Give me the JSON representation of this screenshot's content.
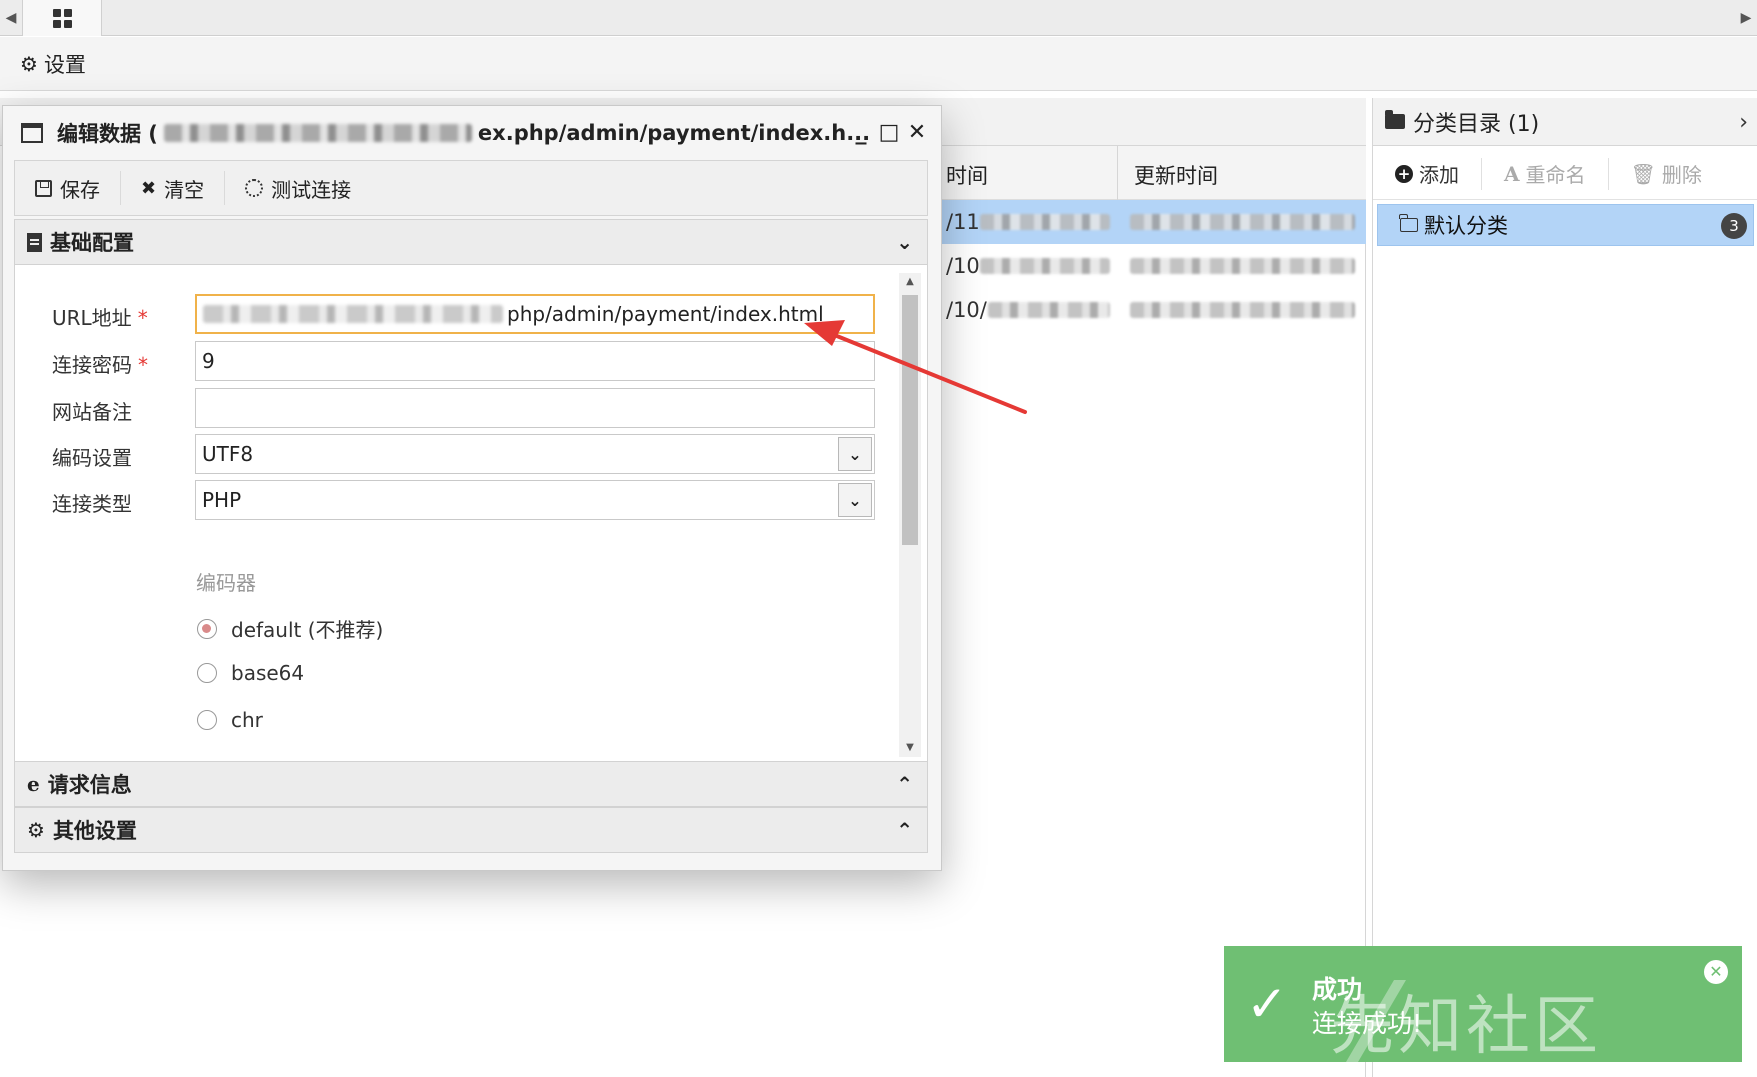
{
  "settings_bar": {
    "label": "设置"
  },
  "grid": {
    "columns": [
      "时间",
      "更新时间"
    ],
    "rows": [
      {
        "date_prefix": "/11"
      },
      {
        "date_prefix": "/10"
      },
      {
        "date_prefix": "/10/"
      }
    ]
  },
  "category_panel": {
    "title": "分类目录 (1)",
    "toolbar": {
      "add": "添加",
      "rename": "重命名",
      "delete": "删除"
    },
    "items": [
      {
        "label": "默认分类",
        "count": "3"
      }
    ]
  },
  "dialog": {
    "title_prefix": "编辑数据 (",
    "title_suffix": "ex.php/admin/payment/index.h...",
    "toolbar": {
      "save": "保存",
      "clear": "清空",
      "test": "测试连接"
    },
    "sections": {
      "basic": "基础配置",
      "request": "请求信息",
      "other": "其他设置"
    },
    "form": {
      "url_label": "URL地址",
      "url_value_visible": "php/admin/payment/index.html",
      "password_label": "连接密码",
      "password_value": "9",
      "note_label": "网站备注",
      "note_value": "",
      "encoding_label": "编码设置",
      "encoding_value": "UTF8",
      "type_label": "连接类型",
      "type_value": "PHP",
      "encoder_label": "编码器",
      "encoders": [
        "default (不推荐)",
        "base64",
        "chr"
      ],
      "encoder_selected": "default (不推荐)",
      "required_mark": "*"
    }
  },
  "toast": {
    "title": "成功",
    "message": "连接成功!"
  },
  "watermark": "先知社区",
  "colors": {
    "toast_bg": "#6fbf73",
    "selected_row": "#b3d4f7",
    "required": "#e53935",
    "active_input_border": "#f0b24a",
    "annotation_arrow": "#e53935"
  }
}
